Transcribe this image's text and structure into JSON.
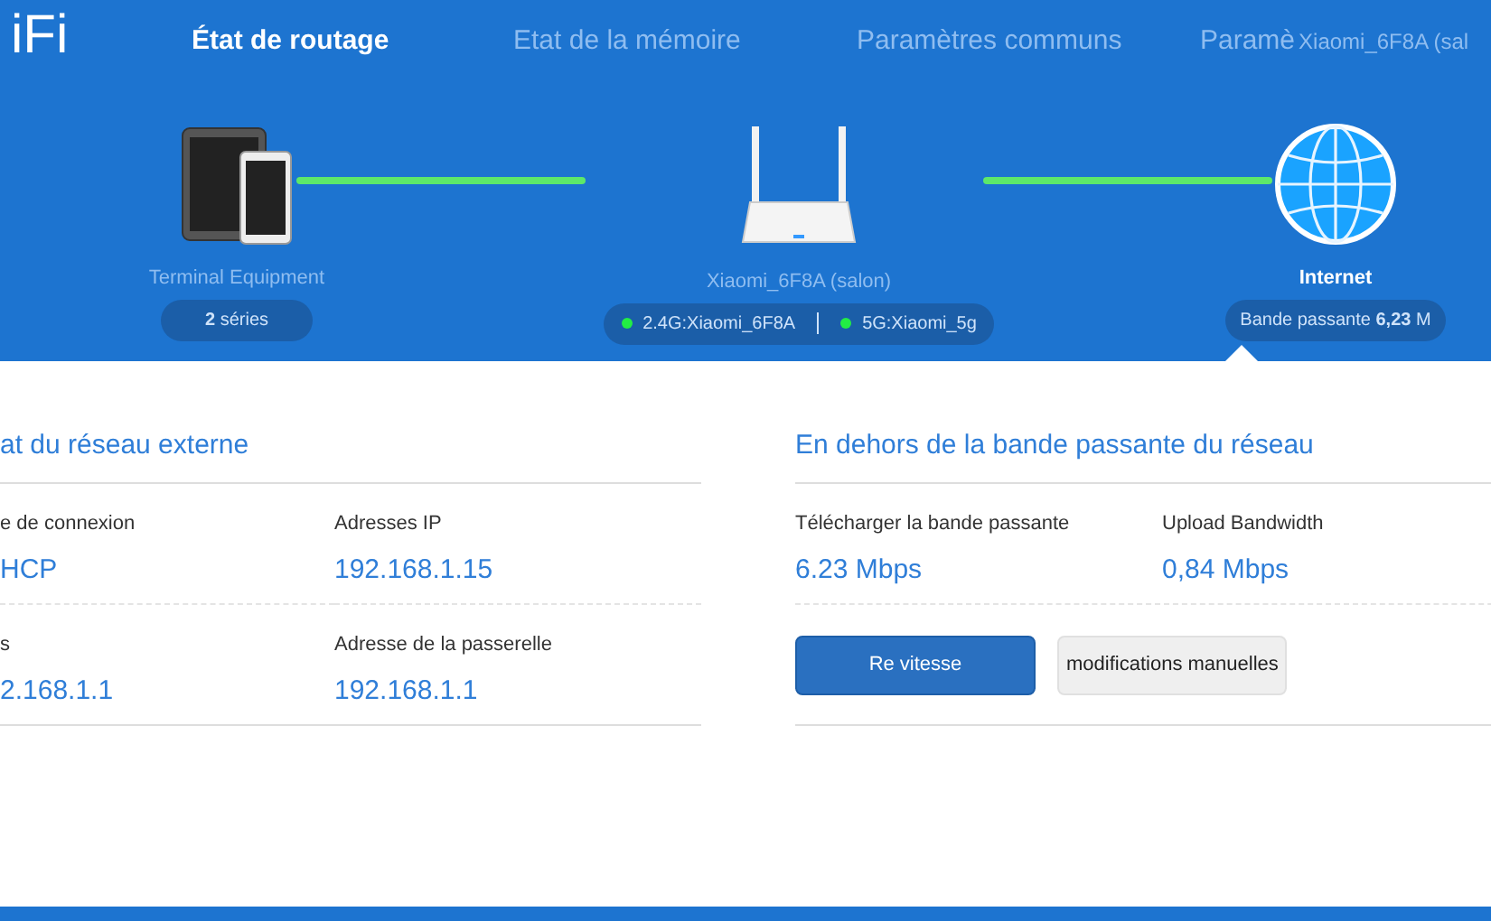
{
  "logo": "iFi",
  "nav": [
    {
      "label": "État de routage",
      "selected": true
    },
    {
      "label": "Etat de la mémoire",
      "selected": false
    },
    {
      "label": "Paramètres communs",
      "selected": false
    },
    {
      "label": "Paramè",
      "selected": false
    }
  ],
  "nav_overlay": "Xiaomi_6F8A (sal",
  "topology": {
    "terminal": {
      "label": "Terminal Equipment",
      "badge": "**2** séries"
    },
    "router": {
      "label": "Xiaomi_6F8A (salon)",
      "networks": [
        {
          "label": "2.4G:Xiaomi_6F8A",
          "color": "#22ee44"
        },
        {
          "label": "5G:Xiaomi_5g",
          "color": "#22ee44"
        }
      ]
    },
    "internet": {
      "label": "Internet",
      "badge": "Bande passante **6,23** M"
    }
  },
  "external_network": {
    "title": "at du réseau externe",
    "fields": [
      {
        "label": "e de connexion",
        "value": "HCP"
      },
      {
        "label": "Adresses IP",
        "value": "192.168.1.15"
      },
      {
        "label": "s",
        "value": "2.168.1.1"
      },
      {
        "label": "Adresse de la passerelle",
        "value": "192.168.1.1"
      }
    ]
  },
  "bandwidth": {
    "title": "En dehors de la bande passante du réseau",
    "fields": [
      {
        "label": "Télécharger la bande passante",
        "value": "6.23 Mbps"
      },
      {
        "label": "Upload Bandwidth",
        "value": "0,84 Mbps"
      }
    ],
    "buttons": [
      {
        "label": "Re vitesse",
        "kind": "primary"
      },
      {
        "label": "modifications manuelles",
        "kind": "secondary"
      }
    ]
  }
}
